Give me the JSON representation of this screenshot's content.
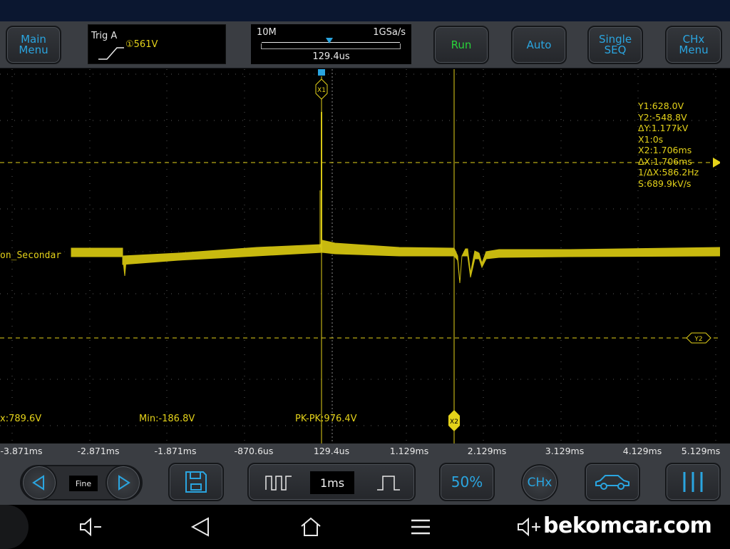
{
  "colors": {
    "trace": "#e4d21a",
    "accent": "#2aa5e0",
    "run": "#29d23a",
    "panel": "#3a3d42"
  },
  "top_bar": {
    "main_menu_label": "Main\nMenu",
    "trigger": {
      "label": "Trig A",
      "level": "①561V",
      "edge_icon": "rising-edge-icon"
    },
    "timebase": {
      "memory_depth": "10M",
      "sample_rate": "1GSa/s",
      "position": "129.4us"
    },
    "run_label": "Run",
    "auto_label": "Auto",
    "single_label": "Single\nSEQ",
    "chx_menu_label": "CHx\nMenu"
  },
  "scope": {
    "channel_label": "on_Secondar",
    "cursor_tags": {
      "x1": "X1",
      "x2": "X2",
      "y2": "Y2"
    },
    "cursor_readout": [
      "Y1:628.0V",
      "Y2:-548.8V",
      "ΔY:1.177kV",
      "X1:0s",
      "X2:1.706ms",
      "ΔX:1.706ms",
      "1/ΔX:586.2Hz",
      "S:689.9kV/s"
    ],
    "measurements": {
      "max": "x:789.6V",
      "min": "Min:-186.8V",
      "pkpk": "PK-PK:976.4V"
    }
  },
  "time_axis": {
    "ticks": [
      "-3.871ms",
      "-2.871ms",
      "-1.871ms",
      "-870.6us",
      "129.4us",
      "1.129ms",
      "2.129ms",
      "3.129ms",
      "4.129ms",
      "5.129ms"
    ]
  },
  "bottom_bar": {
    "fine_label": "Fine",
    "timebase_value": "1ms",
    "fifty_percent_label": "50%",
    "chx_label": "CHx",
    "icons": [
      "chevron-left-icon",
      "chevron-right-icon",
      "save-icon",
      "zoom-in-pulse-icon",
      "zoom-out-pulse-icon",
      "car-icon",
      "menu-lines-icon"
    ]
  },
  "nav_bar": {
    "watermark": "bekomcar.com",
    "icons": [
      "volume-down-icon",
      "back-icon",
      "home-icon",
      "recents-icon",
      "volume-up-icon"
    ]
  }
}
